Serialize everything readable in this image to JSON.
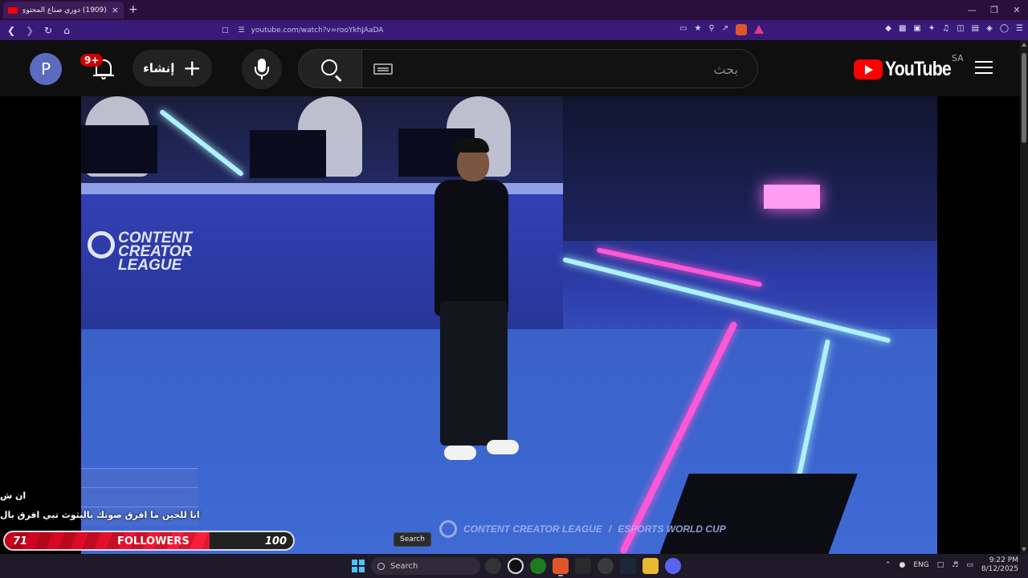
{
  "browser": {
    "tab_title": "(1909) دوري صناع المحتوى - الأس...",
    "tab_close": "×",
    "new_tab": "+",
    "url": "youtube.com/watch?v=rooYkhJAaDA"
  },
  "youtube": {
    "logo_text": "YouTube",
    "country_code": "SA",
    "search_placeholder": "بحث",
    "create_label": "إنشاء",
    "create_icon": "+",
    "notification_count": "9+",
    "avatar_letter": "P"
  },
  "video": {
    "stage_logo_line1": "CONTENT",
    "stage_logo_line2": "CREATOR",
    "stage_logo_line3": "LEAGUE",
    "watermark_left": "CONTENT CREATOR LEAGUE",
    "watermark_right": "ESPORTS WORLD CUP"
  },
  "overlay": {
    "chat_line_1": "ان ش",
    "chat_line_2": "انا للحين ما افرق صوتك بالبثوث تبي افرق بال",
    "followers_current": "71",
    "followers_label": "FOLLOWERS",
    "followers_goal": "100",
    "followers_progress": 0.71,
    "followers_color": "#e0102e"
  },
  "taskbar": {
    "tooltip": "Search",
    "search_label": "Search",
    "language": "ENG",
    "time": "9:22 PM",
    "date": "8/12/2025"
  },
  "colors": {
    "tab_bar": "#2a0f3d",
    "address_bar": "#3a1a78",
    "youtube_red": "#ff0000",
    "avatar": "#5c6bc0"
  }
}
